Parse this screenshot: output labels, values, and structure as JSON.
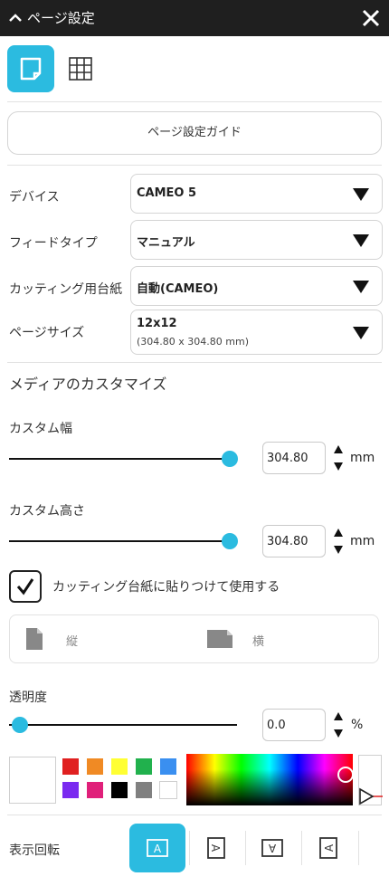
{
  "window": {
    "title": "ページ設定"
  },
  "toolbar": {
    "modes": [
      "page-mode",
      "grid-mode"
    ]
  },
  "guide": {
    "label": "ページ設定ガイド"
  },
  "settings": {
    "device": {
      "label": "デバイス",
      "value": "CAMEO 5"
    },
    "feed_type": {
      "label": "フィードタイプ",
      "value": "マニュアル"
    },
    "cutting_mat": {
      "label": "カッティング用台紙",
      "value": "自動(CAMEO)"
    },
    "page_size": {
      "label": "ページサイズ",
      "value": "12x12",
      "detail": "(304.80 x 304.80 mm)"
    }
  },
  "media": {
    "section_title": "メディアのカスタマイズ",
    "custom_width": {
      "label": "カスタム幅",
      "value": "304.80",
      "unit": "mm",
      "slider_fraction": 1.0
    },
    "custom_height": {
      "label": "カスタム高さ",
      "value": "304.80",
      "unit": "mm",
      "slider_fraction": 1.0
    },
    "use_mat": {
      "label": "カッティング台紙に貼りつけて使用する",
      "checked": true
    },
    "orientation": {
      "portrait": "縦",
      "landscape": "横"
    }
  },
  "transparency": {
    "label": "透明度",
    "value": "0.0",
    "unit": "%",
    "slider_fraction": 0.0
  },
  "colors": {
    "swatches": [
      "#e02020",
      "#f08a24",
      "#ffff33",
      "#21b14d",
      "#3a8ff0",
      "#7a2af0",
      "#e0207a",
      "#000000",
      "#808080",
      "#ffffff"
    ],
    "preview": "#ffffff",
    "accent": "#2bbbe0"
  },
  "rotation": {
    "label": "表示回転",
    "options": [
      "A",
      "A",
      "A",
      "A"
    ]
  }
}
